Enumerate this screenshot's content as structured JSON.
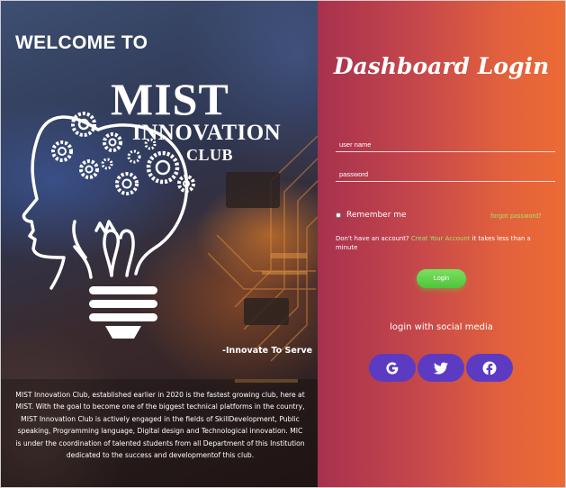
{
  "left": {
    "heading": "WELCOME TO",
    "logo": {
      "line1": "MIST",
      "line2": "INNOVATION",
      "line3": "CLUB"
    },
    "tagline": "-Innovate To Serve",
    "about": "MIST Innovation Club, established earlier in 2020 is the fastest growing club, here at MIST. With the goal to become one of the biggest technical platforms in the country, MIST Innovation Club is actively engaged in the fields of SkillDevelopment, Public speaking, Programming language, Digital design and Technological innovation. MIC is under the coordination of talented students from all Department of this Institution dedicated to the success and developmentof this club."
  },
  "login": {
    "title": "Dashboard Login",
    "username_placeholder": "user name",
    "password_placeholder": "password",
    "remember_label": "Remember me",
    "forgot_label": "forgot password?",
    "signup_prefix": "Don't have an account?",
    "signup_link": "Creat Your Account",
    "signup_suffix": "it takes less than a minute",
    "login_button": "Login"
  },
  "social": {
    "title": "login with social media",
    "buttons": [
      {
        "icon": "google-icon"
      },
      {
        "icon": "twitter-icon"
      },
      {
        "icon": "facebook-icon"
      }
    ]
  },
  "colors": {
    "panel_gradient_start": "#a7314e",
    "panel_gradient_end": "#ec6b34",
    "accent_green": "#a8e16a",
    "login_button": "#5ccc44",
    "social_button": "#5c3bc2"
  }
}
